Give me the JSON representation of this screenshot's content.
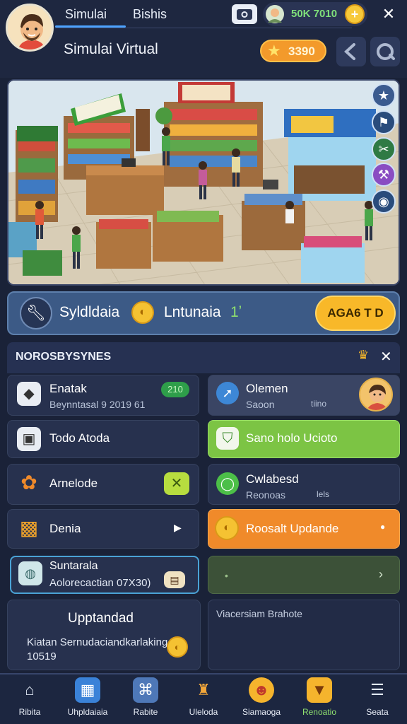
{
  "header": {
    "tabs": [
      "Simulai",
      "Bishis"
    ],
    "coins": "50K 7010",
    "game_title": "Simulai Virtual",
    "stars": "3390"
  },
  "status": {
    "label_left": "Syldldaia",
    "label_right": "Lntunaia",
    "label_right_num": "1ʼ",
    "button": "AGA6 T D"
  },
  "panel": {
    "title": "NOROSBYSYNES",
    "items": [
      {
        "label": "Enatak",
        "sub": "Beynntasal 9 2019 61",
        "badge": "210"
      },
      {
        "label": "Olemen",
        "sub": "Saoon",
        "sub2": "tiino"
      },
      {
        "label": "Todo Atoda"
      },
      {
        "label": "Sano holo Ucioto"
      },
      {
        "label": "Arnelode"
      },
      {
        "label": "Cwlabesd",
        "sub": "Reonoas",
        "sub2": "lels"
      },
      {
        "label": "Denia"
      },
      {
        "label": "Roosalt Updande"
      },
      {
        "label": "Suntarala",
        "sub": "Aolorecactian 07X30)"
      },
      {
        "label": ""
      }
    ],
    "upgrade": {
      "title": "Upptandad",
      "text": "Kiatan Sernudaciandkarlaking",
      "num": "10519"
    },
    "note": "Viacersiam Brahote"
  },
  "nav": [
    {
      "label": "Ribita",
      "icon": "home-icon"
    },
    {
      "label": "Uhpldaiaia",
      "icon": "store-icon"
    },
    {
      "label": "Rabite",
      "icon": "building-icon"
    },
    {
      "label": "Uleloda",
      "icon": "trophy-icon"
    },
    {
      "label": "Siamaoga",
      "icon": "chat-icon"
    },
    {
      "label": "Renoatio",
      "icon": "bag-icon"
    },
    {
      "label": "Seata",
      "icon": "menu-icon"
    }
  ],
  "colors": {
    "accent": "#4da3ff",
    "gold": "#f5c232",
    "green": "#7cc444",
    "orange": "#f08a2a",
    "bg": "#1a2238"
  }
}
